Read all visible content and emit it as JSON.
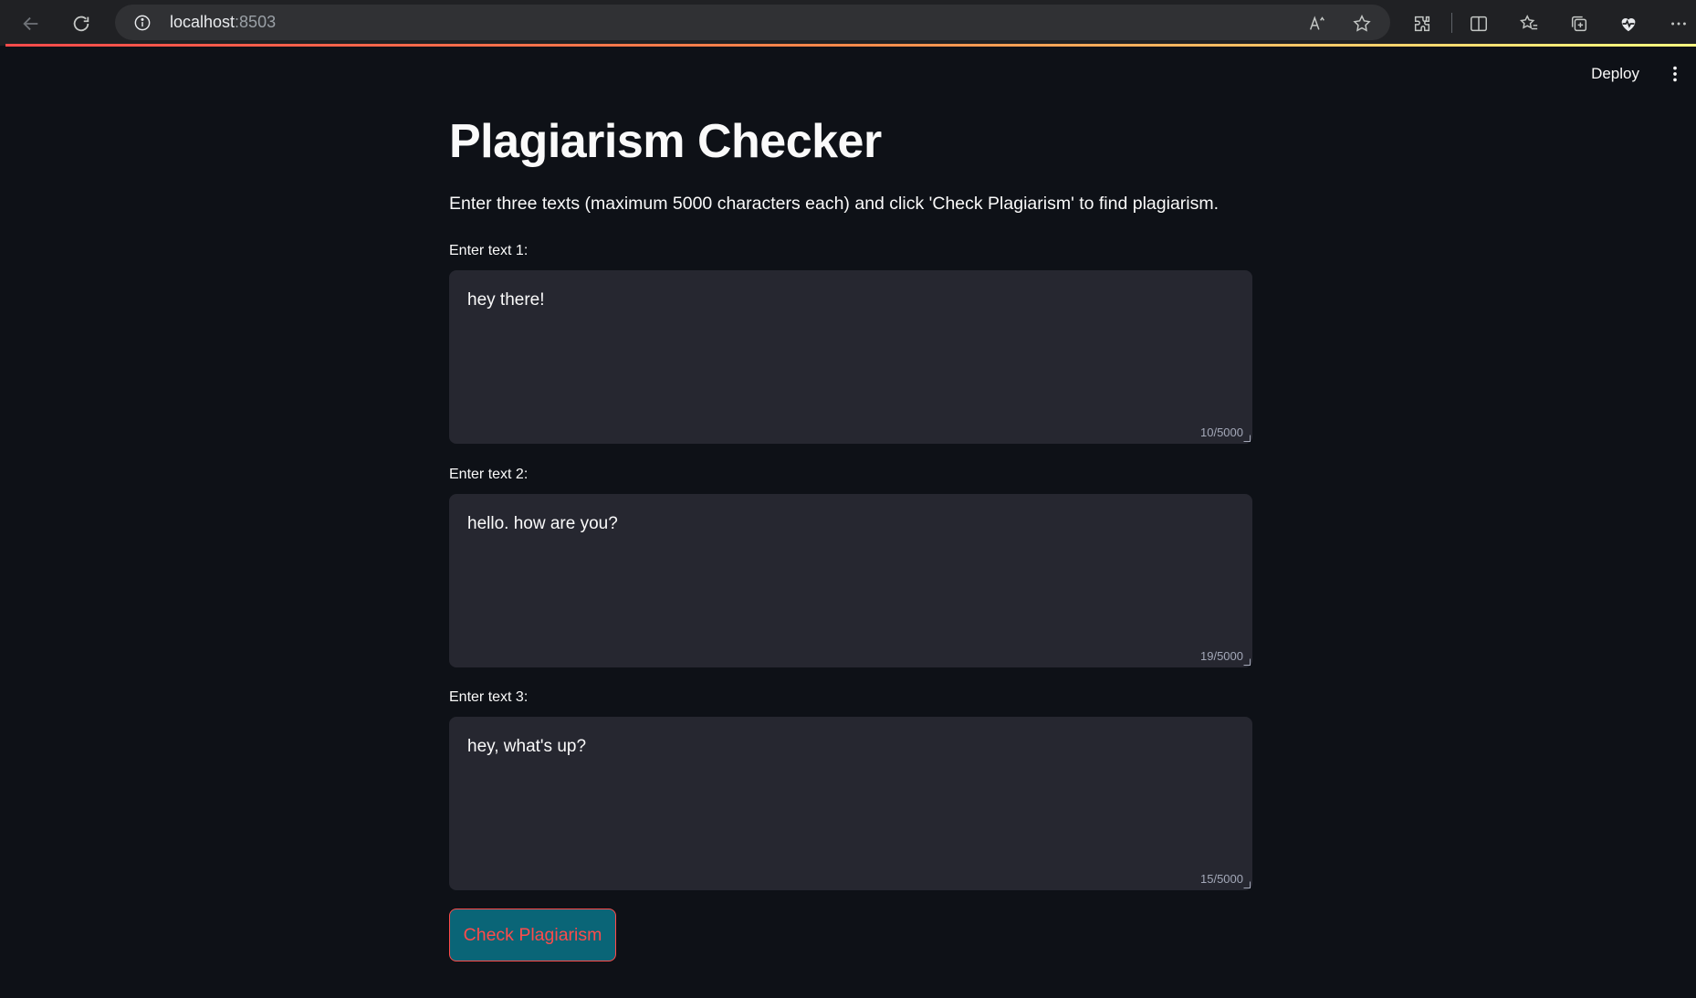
{
  "browser": {
    "url_host": "localhost",
    "url_port": ":8503",
    "icons": [
      "back-icon",
      "refresh-icon",
      "info-icon",
      "read-aloud-icon",
      "favorite-star-icon",
      "extensions-icon",
      "split-screen-icon",
      "favorites-icon",
      "collections-icon",
      "browser-essentials-icon",
      "more-icon"
    ]
  },
  "header": {
    "deploy_label": "Deploy"
  },
  "main": {
    "title": "Plagiarism Checker",
    "description": "Enter three texts (maximum 5000 characters each) and click 'Check Plagiarism' to find plagiarism.",
    "fields": [
      {
        "label": "Enter text 1:",
        "value": "hey there!",
        "counter": "10/5000"
      },
      {
        "label": "Enter text 2:",
        "value": "hello. how are you?",
        "counter": "19/5000"
      },
      {
        "label": "Enter text 3:",
        "value": "hey, what's up?",
        "counter": "15/5000"
      }
    ],
    "button_label": "Check Plagiarism"
  },
  "colors": {
    "background": "#0e1117",
    "input_bg": "#262730",
    "button_bg": "#0a6577",
    "accent": "#ff4b4b"
  }
}
